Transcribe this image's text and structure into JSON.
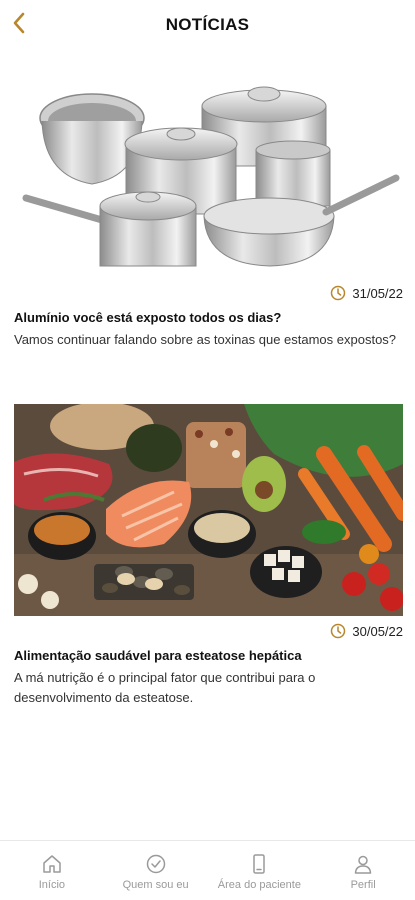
{
  "header": {
    "title": "NOTÍCIAS"
  },
  "colors": {
    "accent": "#b8862d",
    "tab_inactive": "#9a9a9a"
  },
  "articles": [
    {
      "date": "31/05/22",
      "title": "Alumínio você está exposto todos os dias?",
      "description": "Vamos continuar falando sobre as toxinas que estamos expostos?",
      "image": "cookware-pots-illustration"
    },
    {
      "date": "30/05/22",
      "title": "Alimentação saudável para esteatose hepática",
      "description": "A má nutrição é o principal fator que contribui para o desenvolvimento da esteatose.",
      "image": "healthy-food-illustration"
    }
  ],
  "tabbar": {
    "items": [
      {
        "label": "Início",
        "icon": "home-icon"
      },
      {
        "label": "Quem sou eu",
        "icon": "check-circle-icon"
      },
      {
        "label": "Área do paciente",
        "icon": "phone-icon"
      },
      {
        "label": "Perfil",
        "icon": "user-icon"
      }
    ]
  }
}
